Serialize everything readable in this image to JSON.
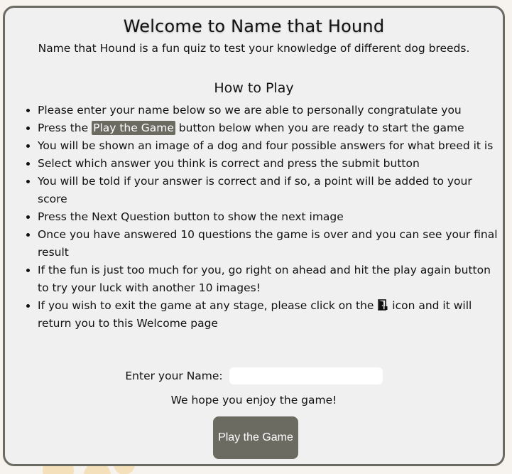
{
  "welcome": {
    "title": "Welcome to Name that Hound",
    "intro": "Name that Hound is a fun quiz to test your knowledge of different dog breeds."
  },
  "how_to_play": {
    "heading": "How to Play",
    "rules": [
      {
        "text": "Please enter your name below so we are able to personally congratulate you"
      },
      {
        "before": "Press the ",
        "highlight": "Play the Game",
        "after": " button below when you are ready to start the game"
      },
      {
        "text": "You will be shown an image of a dog and four possible answers for what breed it is"
      },
      {
        "text": "Select which answer you think is correct and press the submit button"
      },
      {
        "text": "You will be told if your answer is correct and if so, a point will be added to your score"
      },
      {
        "text": "Press the Next Question button to show the next image"
      },
      {
        "text": "Once you have answered 10 questions the game is over and you can see your final result"
      },
      {
        "text": "If the fun is just too much for you, go right on ahead and hit the play again button to try your luck with another 10 images!"
      },
      {
        "before": "If you wish to exit the game at any stage, please click on the ",
        "icon": "door-open-icon",
        "after": " icon and it will return you to this Welcome page"
      }
    ]
  },
  "name_form": {
    "label": "Enter your Name:",
    "value": "",
    "placeholder": ""
  },
  "enjoy_text": "We hope you enjoy the game!",
  "play_button": {
    "label": "Play the Game"
  },
  "colors": {
    "accent": "#6b6b62",
    "card_background": "#f0f0f0",
    "page_background": "#f6f3ee"
  }
}
